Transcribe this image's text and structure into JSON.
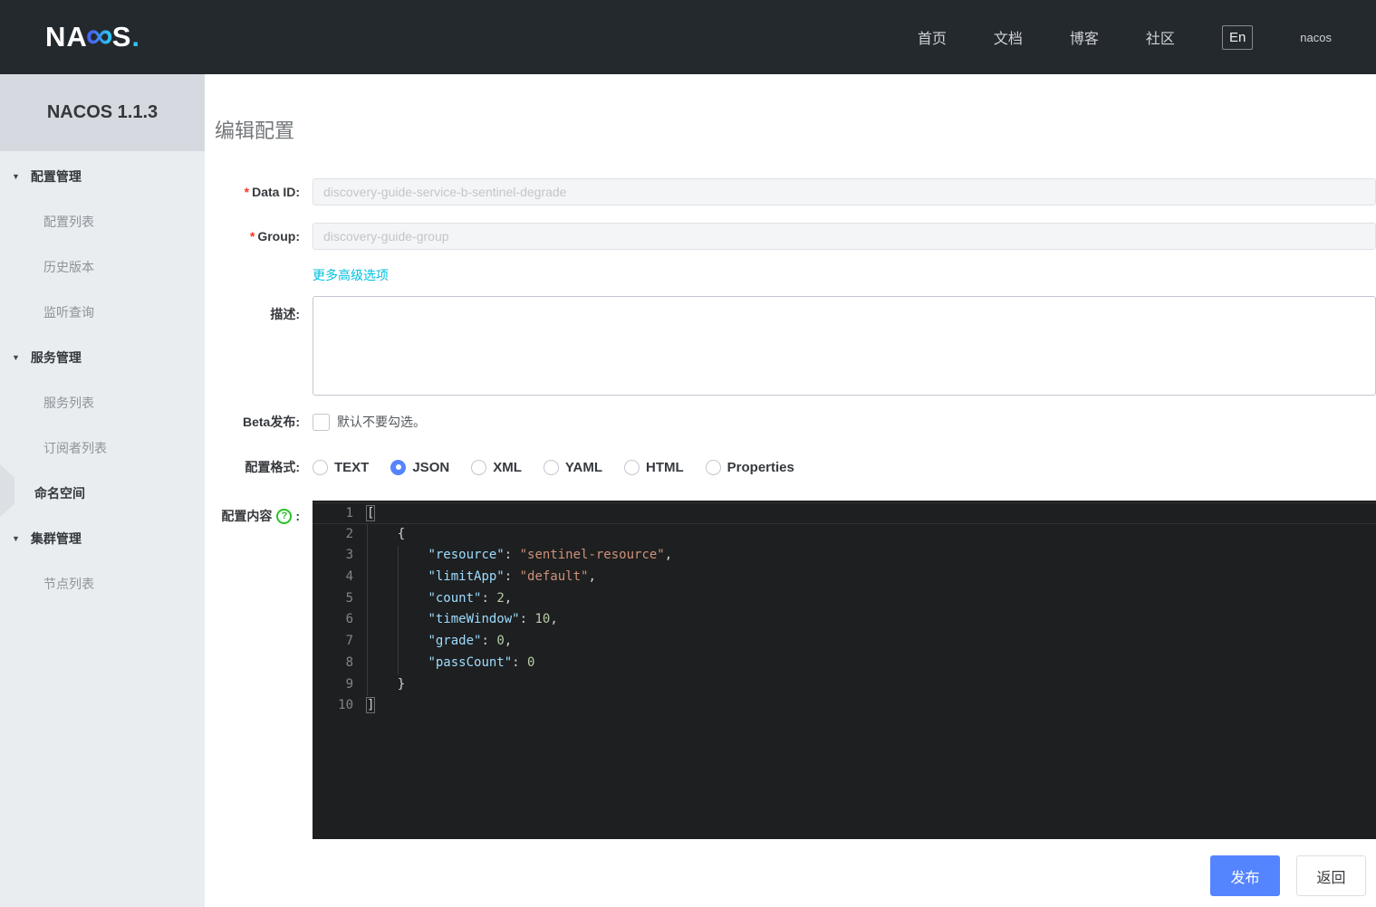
{
  "colors": {
    "header_bg": "#24292e",
    "primary_blue": "#5584ff",
    "link_cyan": "#00c1de",
    "editor_bg": "#1e1f20",
    "sidebar_bg": "#e9edf0",
    "required_red": "#ff3322",
    "help_green": "#27c327"
  },
  "header": {
    "logo": {
      "prefix": "NA",
      "infinity": "∞",
      "suffix": "S",
      "dot": "."
    },
    "nav": [
      {
        "name": "home",
        "label": "首页"
      },
      {
        "name": "docs",
        "label": "文档"
      },
      {
        "name": "blog",
        "label": "博客"
      },
      {
        "name": "community",
        "label": "社区"
      }
    ],
    "lang_button": "En",
    "username": "nacos"
  },
  "sidebar": {
    "title": "NACOS 1.1.3",
    "caret_icon": "▼",
    "items": [
      {
        "type": "group",
        "name": "config-management",
        "label": "配置管理"
      },
      {
        "type": "sub",
        "name": "config-list",
        "label": "配置列表"
      },
      {
        "type": "sub",
        "name": "history-versions",
        "label": "历史版本"
      },
      {
        "type": "sub",
        "name": "listening-query",
        "label": "监听查询"
      },
      {
        "type": "group",
        "name": "service-management",
        "label": "服务管理"
      },
      {
        "type": "sub",
        "name": "service-list",
        "label": "服务列表"
      },
      {
        "type": "sub",
        "name": "subscriber-list",
        "label": "订阅者列表"
      },
      {
        "type": "top",
        "name": "namespace",
        "label": "命名空间"
      },
      {
        "type": "group",
        "name": "cluster-management",
        "label": "集群管理"
      },
      {
        "type": "sub",
        "name": "node-list",
        "label": "节点列表"
      }
    ]
  },
  "form": {
    "title": "编辑配置",
    "required_marker": "*",
    "data_id": {
      "label": "Data ID:",
      "value": "discovery-guide-service-b-sentinel-degrade"
    },
    "group": {
      "label": "Group:",
      "value": "discovery-guide-group"
    },
    "advanced_link": "更多高级选项",
    "description": {
      "label": "描述:",
      "value": ""
    },
    "beta": {
      "label": "Beta发布:",
      "checkbox_text": "默认不要勾选。",
      "checked": false
    },
    "format": {
      "label": "配置格式:",
      "options": [
        "TEXT",
        "JSON",
        "XML",
        "YAML",
        "HTML",
        "Properties"
      ],
      "selected": "JSON"
    },
    "content": {
      "label": "配置内容",
      "help_icon": "?",
      "colon": ":"
    },
    "publish_button": "发布",
    "back_button": "返回"
  },
  "editor": {
    "lines": [
      {
        "n": "1",
        "current": true,
        "tokens": [
          [
            "match",
            "["
          ]
        ]
      },
      {
        "n": "2",
        "tokens": [
          [
            "punct",
            "    {"
          ]
        ]
      },
      {
        "n": "3",
        "tokens": [
          [
            "punct",
            "        "
          ],
          [
            "key",
            "\"resource\""
          ],
          [
            "punct",
            ": "
          ],
          [
            "str",
            "\"sentinel-resource\""
          ],
          [
            "punct",
            ","
          ]
        ]
      },
      {
        "n": "4",
        "tokens": [
          [
            "punct",
            "        "
          ],
          [
            "key",
            "\"limitApp\""
          ],
          [
            "punct",
            ": "
          ],
          [
            "str",
            "\"default\""
          ],
          [
            "punct",
            ","
          ]
        ]
      },
      {
        "n": "5",
        "tokens": [
          [
            "punct",
            "        "
          ],
          [
            "key",
            "\"count\""
          ],
          [
            "punct",
            ": "
          ],
          [
            "num",
            "2"
          ],
          [
            "punct",
            ","
          ]
        ]
      },
      {
        "n": "6",
        "tokens": [
          [
            "punct",
            "        "
          ],
          [
            "key",
            "\"timeWindow\""
          ],
          [
            "punct",
            ": "
          ],
          [
            "num",
            "10"
          ],
          [
            "punct",
            ","
          ]
        ]
      },
      {
        "n": "7",
        "tokens": [
          [
            "punct",
            "        "
          ],
          [
            "key",
            "\"grade\""
          ],
          [
            "punct",
            ": "
          ],
          [
            "num",
            "0"
          ],
          [
            "punct",
            ","
          ]
        ]
      },
      {
        "n": "8",
        "tokens": [
          [
            "punct",
            "        "
          ],
          [
            "key",
            "\"passCount\""
          ],
          [
            "punct",
            ": "
          ],
          [
            "num",
            "0"
          ]
        ]
      },
      {
        "n": "9",
        "tokens": [
          [
            "punct",
            "    }"
          ]
        ]
      },
      {
        "n": "10",
        "tokens": [
          [
            "match",
            "]"
          ]
        ]
      }
    ]
  }
}
